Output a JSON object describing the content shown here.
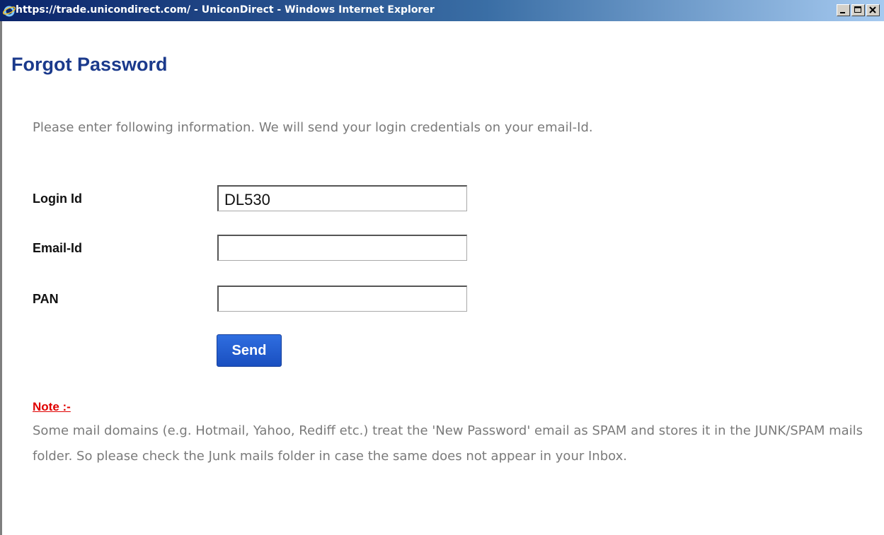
{
  "window": {
    "title": "https://trade.unicondirect.com/ - UniconDirect - Windows Internet Explorer",
    "buttons": [
      "minimize-icon",
      "maximize-icon",
      "close-icon"
    ],
    "icon": "internet-explorer-icon"
  },
  "page": {
    "title": "Forgot Password",
    "intro": "Please enter following information. We will send your login credentials on your email-Id."
  },
  "form": {
    "login_label": "Login Id",
    "login_value": "DL530",
    "email_label": "Email-Id",
    "email_value": "",
    "pan_label": "PAN",
    "pan_value": "",
    "send_label": "Send"
  },
  "note": {
    "label": "Note :-",
    "text": "Some mail domains (e.g. Hotmail, Yahoo, Rediff etc.) treat the 'New Password' email as SPAM and stores it in the JUNK/SPAM mails folder. So please check the Junk mails folder in case the same does not appear in your Inbox."
  },
  "colors": {
    "title": "#1b3a8c",
    "note_label": "#e00000",
    "button": "#1a4fc0",
    "muted_text": "#7a7a7a"
  }
}
